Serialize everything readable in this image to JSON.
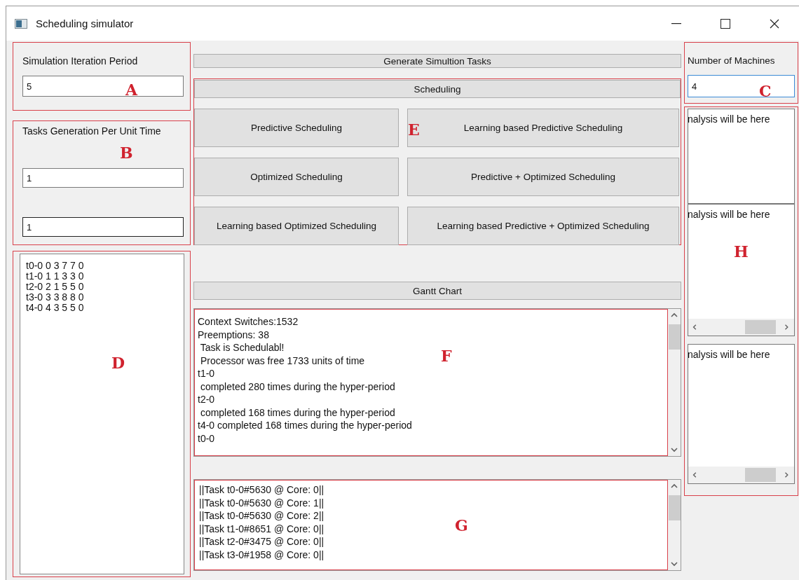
{
  "window": {
    "title": "Scheduling simulator"
  },
  "iteration_period": {
    "label": "Simulation Iteration Period",
    "value": "5",
    "annotation": "A"
  },
  "task_generation": {
    "label": "Tasks Generation Per Unit Time",
    "annotation": "B",
    "fields": [
      {
        "value": "1",
        "hovered": false
      },
      {
        "value": "1",
        "hovered": true
      }
    ]
  },
  "task_list": {
    "annotation": "D",
    "lines": [
      "t0-0 0 3 7 7 0",
      "t1-0 1 1 3 3 0",
      "t2-0 2 1 5 5 0",
      "t3-0 3 3 8 8 0",
      "t4-0 4 3 5 5 0"
    ]
  },
  "generate_button": "Generate Simultion Tasks",
  "scheduling": {
    "header": "Scheduling",
    "annotation": "E",
    "buttons": [
      "Predictive Scheduling",
      "Learning based Predictive Scheduling",
      "Optimized Scheduling",
      "Predictive + Optimized Scheduling",
      "Learning based Optimized Scheduling",
      "Learning based Predictive + Optimized Scheduling"
    ]
  },
  "gantt_button": "Gantt Chart",
  "log_output": {
    "annotation": "F",
    "lines": [
      "Context Switches:1532",
      "Preemptions: 38",
      " Task is Schedulabl!",
      " Processor was free 1733 units of time",
      "t1-0",
      " completed 280 times during the hyper-period",
      "t2-0",
      " completed 168 times during the hyper-period",
      "t4-0 completed 168 times during the hyper-period",
      "t0-0"
    ]
  },
  "core_output": {
    "annotation": "G",
    "lines": [
      "||Task t0-0#5630 @ Core: 0||",
      "||Task t0-0#5630 @ Core: 1||",
      "||Task t0-0#5630 @ Core: 2||",
      "||Task t1-0#8651 @ Core: 0||",
      "||Task t2-0#3475 @ Core: 0||",
      "||Task t3-0#1958 @ Core: 0||"
    ]
  },
  "machines": {
    "label": "Number of Machines",
    "value": "4",
    "focused": true,
    "annotation": "C"
  },
  "analysis": {
    "annotation": "H",
    "panels": [
      {
        "text": "nalysis will be here",
        "h_scrollbar": false
      },
      {
        "text": "nalysis will be here",
        "h_scrollbar": true
      },
      {
        "text": "nalysis will be here",
        "h_scrollbar": true
      }
    ]
  }
}
